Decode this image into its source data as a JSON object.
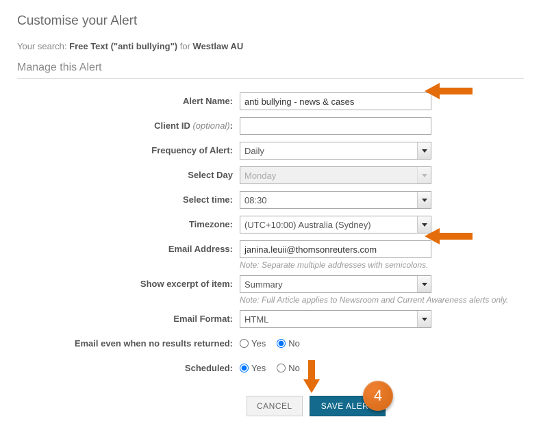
{
  "page_title": "Customise your Alert",
  "search_prefix": "Your search: ",
  "search_query": "Free Text (\"anti bullying\")",
  "search_for": " for ",
  "search_source": "Westlaw AU",
  "section_title": "Manage this Alert",
  "labels": {
    "alert_name": "Alert Name:",
    "client_id": "Client ID ",
    "client_id_optional": "(optional)",
    "client_id_colon": ":",
    "frequency": "Frequency of Alert:",
    "select_day": "Select Day",
    "select_time": "Select time:",
    "timezone": "Timezone:",
    "email": "Email Address:",
    "excerpt": "Show excerpt of item:",
    "email_format": "Email Format:",
    "no_results": "Email even when no results returned:",
    "scheduled": "Scheduled:"
  },
  "values": {
    "alert_name": "anti bullying - news & cases",
    "client_id": "",
    "frequency": "Daily",
    "select_day": "Monday",
    "select_time": "08:30",
    "timezone": "(UTC+10:00) Australia (Sydney)",
    "email": "janina.leuii@thomsonreuters.com",
    "excerpt": "Summary",
    "email_format": "HTML"
  },
  "notes": {
    "email": "Note: Separate multiple addresses with semicolons.",
    "excerpt": "Note: Full Article applies to Newsroom and Current Awareness alerts only."
  },
  "radio": {
    "yes": "Yes",
    "no": "No"
  },
  "buttons": {
    "cancel": "CANCEL",
    "save": "SAVE ALERT"
  },
  "badge": "4"
}
